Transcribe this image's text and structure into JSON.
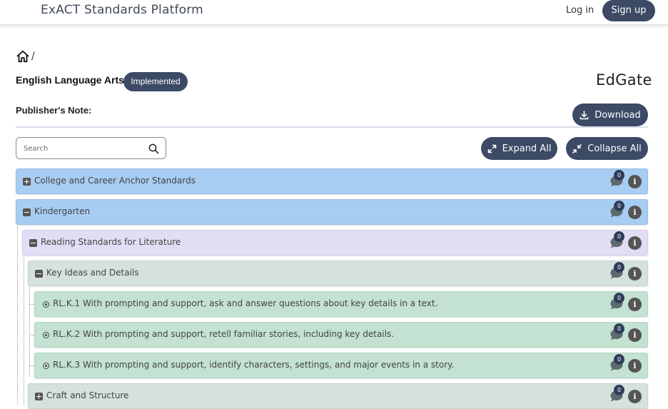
{
  "header": {
    "brand": "ExACT Standards Platform",
    "login_label": "Log in",
    "signup_label": "Sign up"
  },
  "breadcrumb": {
    "separator": "/",
    "home_icon": "home-icon"
  },
  "subject": {
    "title": "English Language Arts",
    "status": "Implemented",
    "publisher": "EdGate",
    "publisher_note_label": "Publisher's Note:"
  },
  "toolbar": {
    "download_label": "Download",
    "expand_label": "Expand All",
    "collapse_label": "Collapse All",
    "search_placeholder": "Search",
    "search_value": ""
  },
  "colors": {
    "accent": "#3c4a66",
    "level0": "#a8cdf3",
    "level1": "#e2ddf5",
    "level2": "#d5e1dc",
    "level3": "#c3e2d2"
  },
  "tree": [
    {
      "label": "College and Career Anchor Standards",
      "level": 0,
      "toggle": "plus",
      "comments": "0"
    },
    {
      "label": "Kindergarten",
      "level": 0,
      "toggle": "minus",
      "comments": "0"
    },
    {
      "label": "Reading Standards for Literature",
      "level": 1,
      "toggle": "minus",
      "comments": "0"
    },
    {
      "label": "Key Ideas and Details",
      "level": 2,
      "toggle": "minus",
      "comments": "0"
    },
    {
      "label": "RL.K.1 With prompting and support, ask and answer questions about key details in a text.",
      "level": 3,
      "toggle": "leaf",
      "comments": "0"
    },
    {
      "label": "RL.K.2 With prompting and support, retell familiar stories, including key details.",
      "level": 3,
      "toggle": "leaf",
      "comments": "0"
    },
    {
      "label": "RL.K.3 With prompting and support, identify characters, settings, and major events in a story.",
      "level": 3,
      "toggle": "leaf",
      "comments": "0"
    },
    {
      "label": "Craft and Structure",
      "level": 2,
      "toggle": "plus",
      "comments": "0"
    }
  ]
}
